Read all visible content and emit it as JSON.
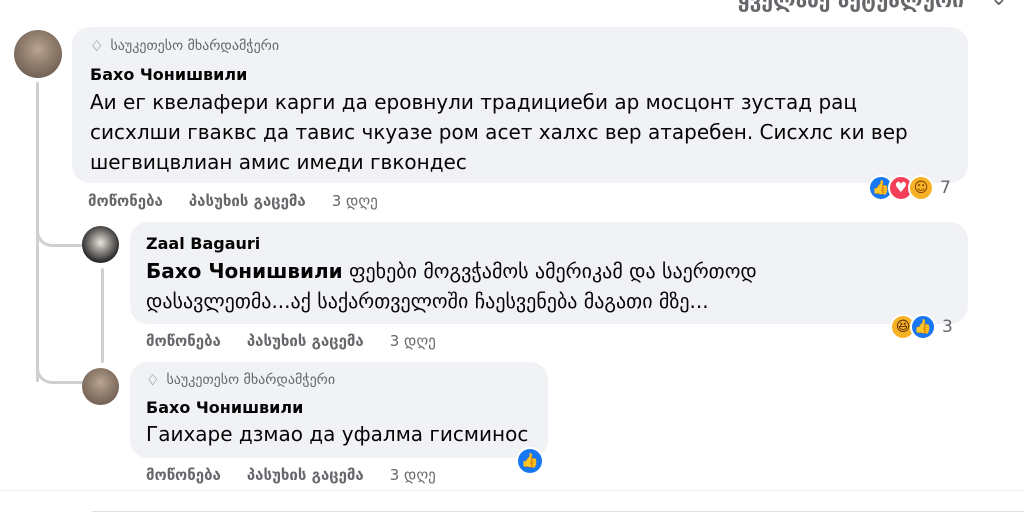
{
  "header": {
    "sort_label": "ყველაზე აქტუალური",
    "chevron": "chevron-down-icon"
  },
  "comments": [
    {
      "badge_icon": "diamond-icon",
      "badge": "საუკეთესო მხარდამჭერი",
      "author": "Бахо Чонишвили",
      "lines": [
        "Аи ег квелафери карги да еровнули традициеби ар мосцонт зустад рац",
        "сисхлши гваквс да тавис чкуазе ром асет халхс вер атаребен. Сисхлс ки вер",
        "шегвицвлиан амис имеди гвкондес"
      ],
      "like": "მოწონება",
      "reply": "პასუხის გაცემა",
      "time": "3 დღე",
      "reactions": [
        "like",
        "love",
        "care"
      ],
      "reaction_count": "7"
    },
    {
      "author": "Zaal Bagauri",
      "mention": "Бахо Чонишвили",
      "line1": "ფეხები მოგვჭამოს ამერიკამ და საერთოდ",
      "line2": "დასავლეთმა...აქ საქართველოში ჩაესვენება მაგათი მზე...",
      "like": "მოწონება",
      "reply": "პასუხის გაცემა",
      "time": "3 დღე",
      "reactions": [
        "haha",
        "like"
      ],
      "reaction_count": "3"
    },
    {
      "badge_icon": "diamond-icon",
      "badge": "საუკეთესო მხარდამჭერი",
      "author": "Бахо Чонишвили",
      "line1": "Гаихаре дзмао да уфалма гисминос",
      "like": "მოწონება",
      "reply": "პასუხის გაცემა",
      "time": "3 დღე",
      "reactions": [
        "like"
      ]
    }
  ],
  "colors": {
    "bubble": "#f0f2f5",
    "meta": "#65676b",
    "like_blue": "#1877f2",
    "love_red": "#f33e58",
    "haha_yellow": "#f7b125"
  }
}
